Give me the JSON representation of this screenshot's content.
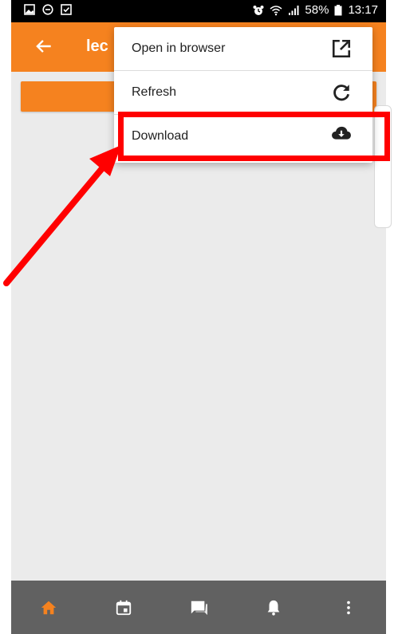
{
  "status_bar": {
    "battery": "58%",
    "time": "13:17",
    "left_icons": [
      "image-icon",
      "minus-circle-icon",
      "checkbox-icon"
    ],
    "right_icons": [
      "alarm-icon",
      "wifi-icon",
      "signal-icon",
      "battery-icon"
    ]
  },
  "app_bar": {
    "title": "lec",
    "back_icon": "arrow-left-icon",
    "color": "#f5821f"
  },
  "menu": {
    "items": [
      {
        "label": "Open in browser",
        "icon": "open-external-icon"
      },
      {
        "label": "Refresh",
        "icon": "refresh-icon"
      },
      {
        "label": "Download",
        "icon": "cloud-download-icon"
      }
    ]
  },
  "bottom_nav": {
    "items": [
      {
        "icon": "home-icon",
        "active": true
      },
      {
        "icon": "calendar-icon",
        "active": false
      },
      {
        "icon": "chat-icon",
        "active": false
      },
      {
        "icon": "bell-icon",
        "active": false
      },
      {
        "icon": "more-vert-icon",
        "active": false
      }
    ],
    "active_color": "#f5821f",
    "inactive_color": "#ffffff",
    "background": "#616161"
  },
  "annotation": {
    "color": "#ff0000"
  }
}
